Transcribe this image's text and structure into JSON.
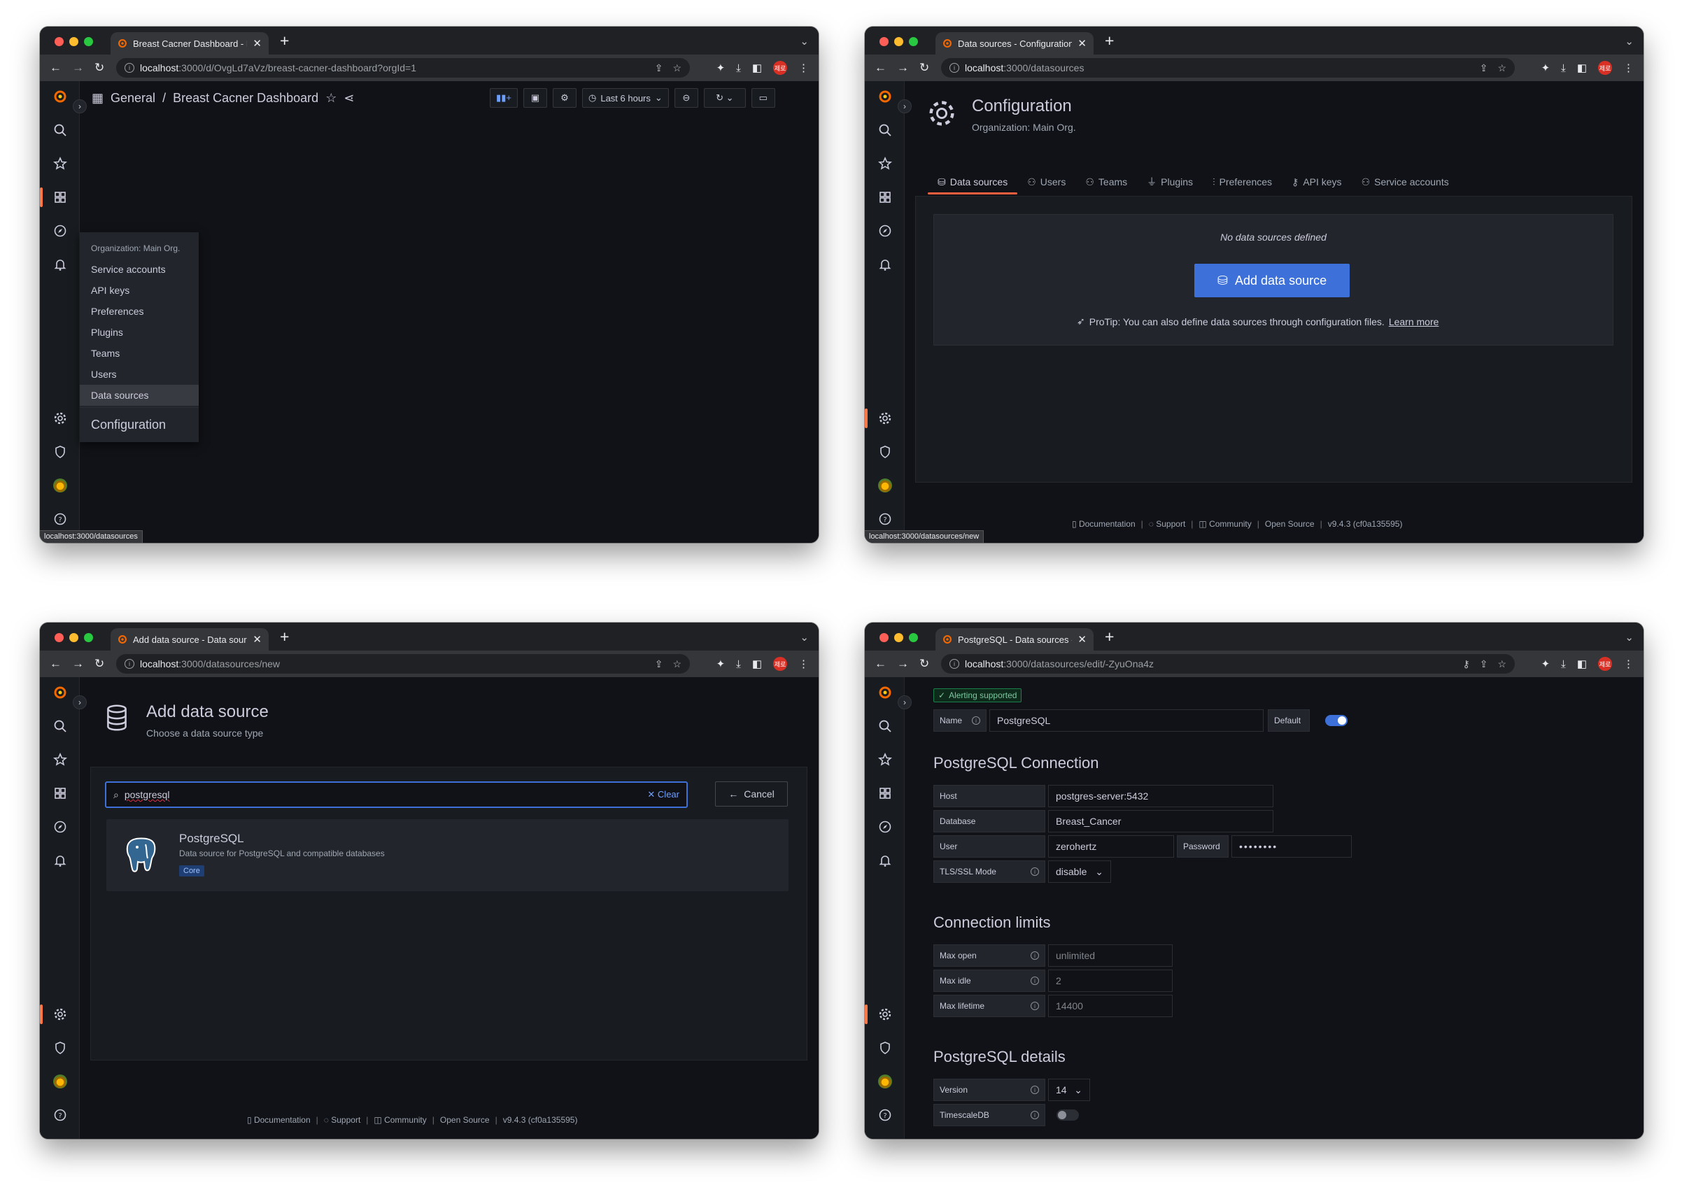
{
  "colors": {
    "grafana_orange": "#f55f3e",
    "primary_blue": "#3d71d9",
    "bg": "#111217",
    "panel": "#181b1f"
  },
  "browser": {
    "profile_initials": "제로"
  },
  "win1": {
    "tab_title": "Breast Cacner Dashboard - Da",
    "url_host": "localhost",
    "url_path": ":3000/d/OvgLd7aVz/breast-cacner-dashboard?orgId=1",
    "breadcrumb_folder": "General",
    "breadcrumb_sep": "/",
    "dashboard_title": "Breast Cacner Dashboard",
    "time_range": "Last 6 hours",
    "menu": {
      "header": "Organization: Main Org.",
      "items": [
        "Service accounts",
        "API keys",
        "Preferences",
        "Plugins",
        "Teams",
        "Users",
        "Data sources"
      ],
      "footer": "Configuration"
    },
    "status_url": "localhost:3000/datasources"
  },
  "win2": {
    "tab_title": "Data sources - Configuration -",
    "url_host": "localhost",
    "url_path": ":3000/datasources",
    "title": "Configuration",
    "subtitle": "Organization: Main Org.",
    "tabs": [
      "Data sources",
      "Users",
      "Teams",
      "Plugins",
      "Preferences",
      "API keys",
      "Service accounts"
    ],
    "empty_text": "No data sources defined",
    "add_button": "Add data source",
    "protip": "ProTip: You can also define data sources through configuration files.",
    "learn_more": "Learn more",
    "footer": [
      "Documentation",
      "Support",
      "Community",
      "Open Source",
      "v9.4.3 (cf0a135595)"
    ],
    "status_url": "localhost:3000/datasources/new"
  },
  "win3": {
    "tab_title": "Add data source - Data source",
    "url_host": "localhost",
    "url_path": ":3000/datasources/new",
    "title": "Add data source",
    "subtitle": "Choose a data source type",
    "search_value": "postgresql",
    "clear_label": "Clear",
    "cancel_label": "Cancel",
    "result": {
      "name": "PostgreSQL",
      "description": "Data source for PostgreSQL and compatible databases",
      "badge": "Core"
    },
    "footer": [
      "Documentation",
      "Support",
      "Community",
      "Open Source",
      "v9.4.3 (cf0a135595)"
    ]
  },
  "win4": {
    "tab_title": "PostgreSQL - Data sources - C",
    "url_host": "localhost",
    "url_path": ":3000/datasources/edit/-ZyuOna4z",
    "alerting": "Alerting supported",
    "name_label": "Name",
    "name_value": "PostgreSQL",
    "default_label": "Default",
    "default_on": true,
    "conn_title": "PostgreSQL Connection",
    "host_label": "Host",
    "host_value": "postgres-server:5432",
    "db_label": "Database",
    "db_value": "Breast_Cancer",
    "user_label": "User",
    "user_value": "zerohertz",
    "password_label": "Password",
    "password_value": "••••••••",
    "tls_label": "TLS/SSL Mode",
    "tls_value": "disable",
    "limits_title": "Connection limits",
    "max_open_label": "Max open",
    "max_open_ph": "unlimited",
    "max_idle_label": "Max idle",
    "max_idle_ph": "2",
    "max_lifetime_label": "Max lifetime",
    "max_lifetime_ph": "14400",
    "details_title": "PostgreSQL details",
    "version_label": "Version",
    "version_value": "14",
    "timescale_label": "TimescaleDB"
  }
}
